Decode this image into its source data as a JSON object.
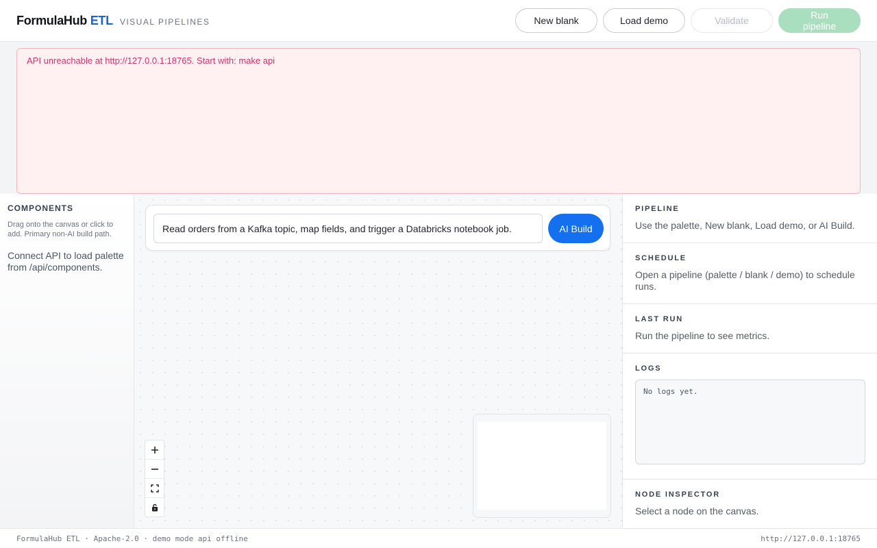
{
  "header": {
    "brand_main": "FormulaHub",
    "brand_accent": "ETL",
    "brand_sub": "Visual Pipelines",
    "new_blank_label": "New blank",
    "load_demo_label": "Load demo",
    "validate_label": "Validate",
    "run_label": "Run pipeline"
  },
  "banner": {
    "message": "API unreachable at http://127.0.0.1:18765. Start with: make api"
  },
  "sidebar": {
    "title": "Components",
    "hint": "Drag onto the canvas or click to add. Primary non-AI build path.",
    "message": "Connect API to load palette from /api/components."
  },
  "canvas": {
    "ai_prompt_value": "Read orders from a Kafka topic, map fields, and trigger a Databricks notebook job.",
    "ai_build_label": "AI Build",
    "zoom_controls": [
      "plus-icon",
      "minus-icon",
      "fit-view-icon",
      "lock-icon"
    ]
  },
  "right_panel": {
    "pipeline": {
      "title": "Pipeline",
      "text": "Use the palette, New blank, Load demo, or AI Build."
    },
    "schedule": {
      "title": "Schedule",
      "text": "Open a pipeline (palette / blank / demo) to schedule runs."
    },
    "last_run": {
      "title": "Last run",
      "text": "Run the pipeline to see metrics."
    },
    "logs": {
      "title": "Logs",
      "value": "No logs yet."
    },
    "node_inspector": {
      "title": "Node inspector",
      "text": "Select a node on the canvas."
    }
  },
  "footer": {
    "left": "FormulaHub ETL · Apache-2.0 · demo mode api offline",
    "right": "http://127.0.0.1:18765"
  },
  "colors": {
    "accent": "#1570ef",
    "error_text": "#d6336c",
    "error_bg": "#fff0f2",
    "run_disabled": "#a9dfbf"
  }
}
